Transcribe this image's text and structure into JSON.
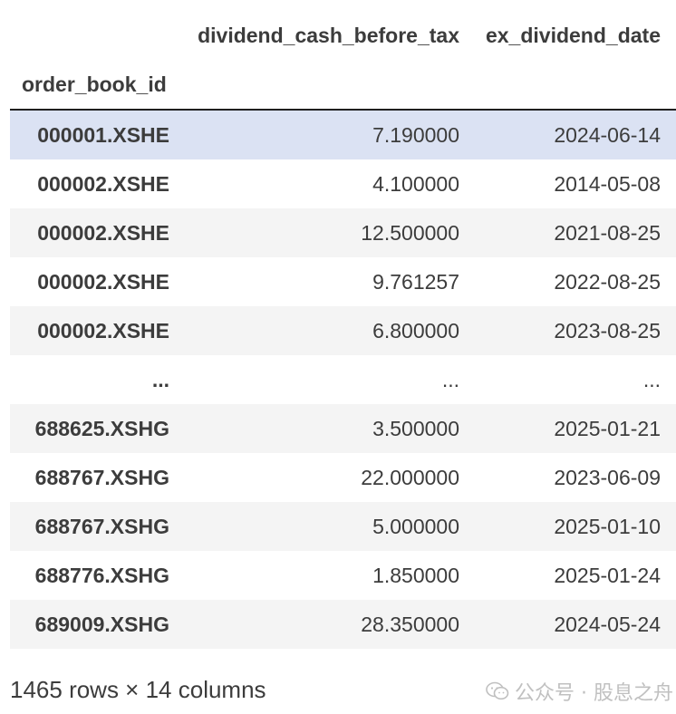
{
  "table": {
    "columns": {
      "cash": "dividend_cash_before_tax",
      "date": "ex_dividend_date",
      "index_name": "order_book_id"
    },
    "rows": [
      {
        "index": "000001.XSHE",
        "cash": "7.190000",
        "date": "2024-06-14",
        "highlight": true
      },
      {
        "index": "000002.XSHE",
        "cash": "4.100000",
        "date": "2014-05-08"
      },
      {
        "index": "000002.XSHE",
        "cash": "12.500000",
        "date": "2021-08-25"
      },
      {
        "index": "000002.XSHE",
        "cash": "9.761257",
        "date": "2022-08-25"
      },
      {
        "index": "000002.XSHE",
        "cash": "6.800000",
        "date": "2023-08-25"
      },
      {
        "index": "...",
        "cash": "...",
        "date": "..."
      },
      {
        "index": "688625.XSHG",
        "cash": "3.500000",
        "date": "2025-01-21"
      },
      {
        "index": "688767.XSHG",
        "cash": "22.000000",
        "date": "2023-06-09"
      },
      {
        "index": "688767.XSHG",
        "cash": "5.000000",
        "date": "2025-01-10"
      },
      {
        "index": "688776.XSHG",
        "cash": "1.850000",
        "date": "2025-01-24"
      },
      {
        "index": "689009.XSHG",
        "cash": "28.350000",
        "date": "2024-05-24"
      }
    ]
  },
  "footer": {
    "shape_text": "1465 rows × 14 columns"
  },
  "watermark": {
    "icon": "wechat-icon",
    "text": "公众号 · 股息之舟"
  },
  "colors": {
    "highlight_row": "#dbe2f3",
    "stripe_row": "#f4f4f4",
    "text": "#3c3c3c",
    "header_rule": "#1f1f1f"
  }
}
